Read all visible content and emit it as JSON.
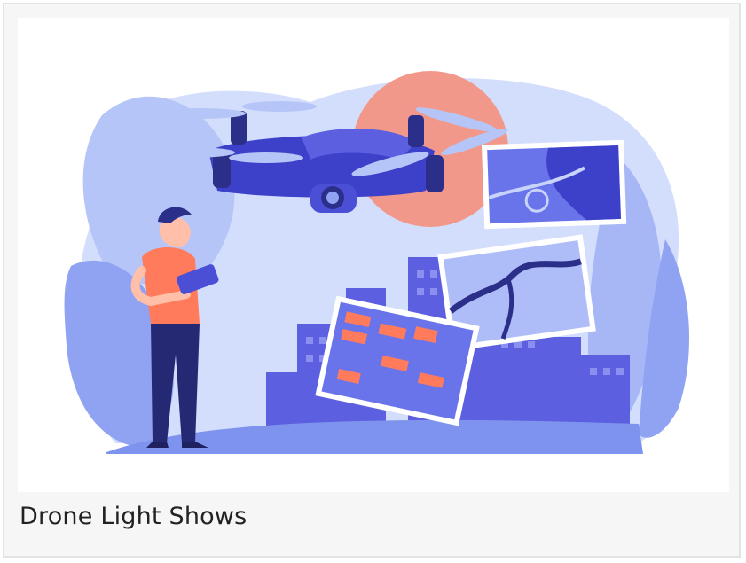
{
  "card": {
    "title": "Drone Light Shows",
    "image": {
      "subject": "drone-pilot-illustration",
      "colors": {
        "primary": "#4b4fd6",
        "light": "#c7d3fb",
        "mid": "#8fa3f2",
        "sun": "#f2988a",
        "skin": "#ff7b5c"
      }
    }
  }
}
